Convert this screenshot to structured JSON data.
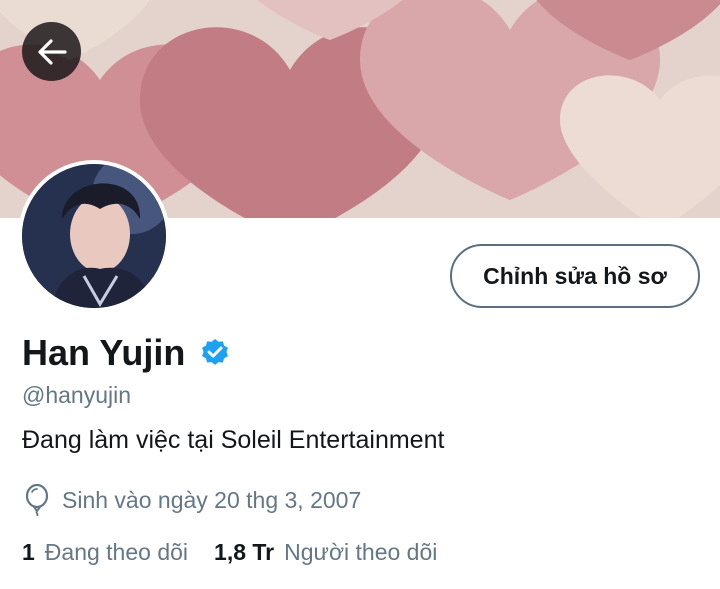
{
  "header": {
    "back_icon": "arrow-left-icon"
  },
  "profile": {
    "display_name": "Han Yujin",
    "verified_icon": "verified-badge-icon",
    "verified_color": "#1da1f2",
    "handle": "@hanyujin",
    "bio": "Đang làm việc tại Soleil Entertainment",
    "birth_icon": "balloon-icon",
    "birth_text": "Sinh vào ngày 20 thg 3, 2007",
    "edit_button_label": "Chỉnh sửa hồ sơ"
  },
  "stats": {
    "following_count": "1",
    "following_label": "Đang theo dõi",
    "followers_count": "1,8 Tr",
    "followers_label": "Người theo dõi"
  },
  "colors": {
    "primary_text": "#14171a",
    "secondary_text": "#657786",
    "button_border": "#5c6f7f"
  }
}
